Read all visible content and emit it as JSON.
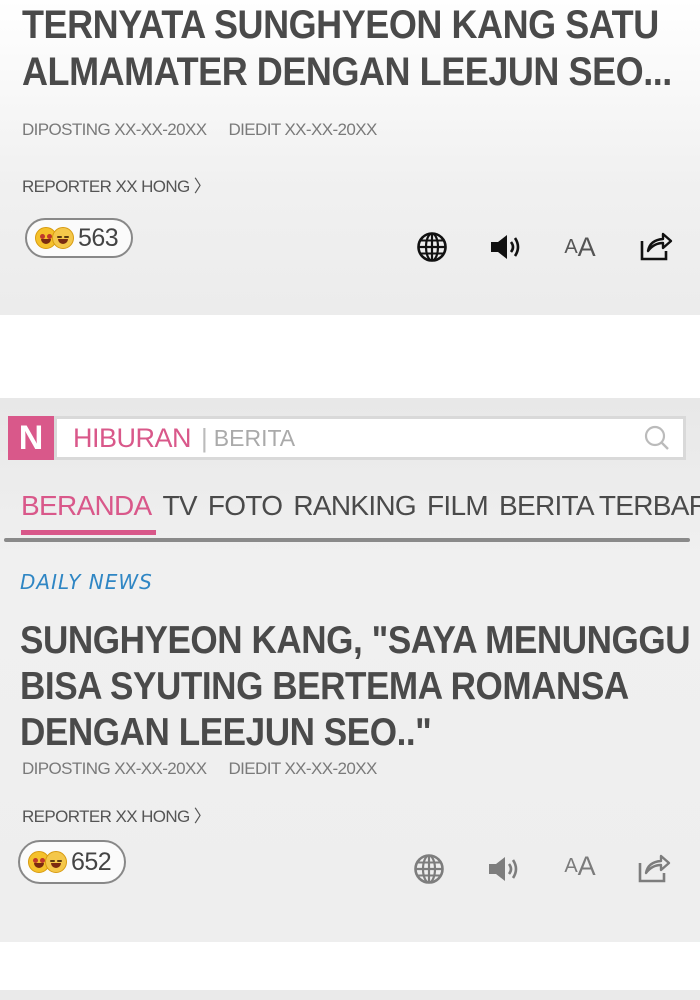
{
  "article1": {
    "title_line1": "TERNYATA SUNGHYEON KANG SATU",
    "title_line2": "ALMAMATER DENGAN LEEJUN SEO...",
    "posted": "DIPOSTING XX-XX-20XX",
    "edited": "DIEDIT XX-XX-20XX",
    "reporter": "REPORTER XX HONG 〉",
    "reaction_count": "563"
  },
  "search": {
    "logo": "N",
    "section": "HIBURAN",
    "separator": "|",
    "subsection": "BERITA"
  },
  "tabs": [
    "BERANDA",
    "TV",
    "FOTO",
    "RANKING",
    "FILM",
    "BERITA TERBARU"
  ],
  "daily_logo": "DAILY NEWS",
  "article2": {
    "title_line1": "SUNGHYEON KANG, \"SAYA MENUNGGU",
    "title_line2": "BISA SYUTING BERTEMA ROMANSA",
    "title_line3": "DENGAN LEEJUN SEO..\"",
    "posted": "DIPOSTING XX-XX-20XX",
    "edited": "DIEDIT XX-XX-20XX",
    "reporter": "REPORTER XX HONG 〉",
    "reaction_count": "652"
  },
  "tools": {
    "font_small": "A",
    "font_big": "A"
  },
  "icons": [
    "globe-icon",
    "speaker-icon",
    "font-size-icon",
    "share-icon",
    "search-icon"
  ],
  "colors": {
    "accent": "#d9588a",
    "daily_news": "#2f86c4",
    "text": "#4a4a4a"
  }
}
